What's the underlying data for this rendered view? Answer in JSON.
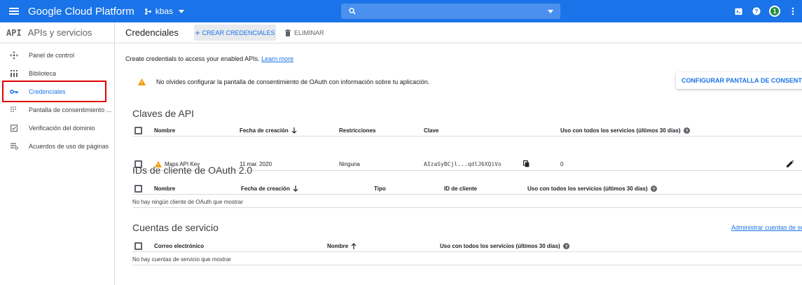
{
  "topbar": {
    "brand": "Google Cloud Platform",
    "project": "kbas",
    "search_value": "",
    "avatar_label": "1",
    "color": "#1a73e8"
  },
  "sidebar": {
    "logo": "API",
    "title": "APIs y servicios",
    "items": [
      {
        "label": "Panel de control",
        "icon": "dashboard-icon"
      },
      {
        "label": "Biblioteca",
        "icon": "library-icon"
      },
      {
        "label": "Credenciales",
        "icon": "key-icon",
        "active": true
      },
      {
        "label": "Pantalla de consentimiento ...",
        "icon": "consent-icon"
      },
      {
        "label": "Verificación del dominio",
        "icon": "domain-check-icon"
      },
      {
        "label": "Acuerdos de uso de páginas",
        "icon": "agreements-icon"
      }
    ]
  },
  "main": {
    "title": "Credenciales",
    "create_label": "CREAR CREDENCIALES",
    "delete_label": "ELIMINAR",
    "intro_text": "Create credentials to access your enabled APIs.",
    "intro_link": "Learn more",
    "alert_text": "No olvides configurar la pantalla de consentimiento de OAuth con información sobre tu aplicación.",
    "config_button": "CONFIGURAR PANTALLA DE CONSENTIMIENTO"
  },
  "api_keys": {
    "title": "Claves de API",
    "headers": [
      "Nombre",
      "Fecha de creación",
      "Restricciones",
      "Clave",
      "Uso con todos los servicios (últimos 30 días)"
    ],
    "rows": [
      {
        "name": "Maps API Key",
        "date": "11 mar. 2020",
        "restrictions": "Ninguna",
        "key": "AIzaSyBCjl...qdlJ6XQiVo",
        "usage": "0"
      }
    ]
  },
  "oauth": {
    "title": "IDs de cliente de OAuth 2.0",
    "headers": [
      "Nombre",
      "Fecha de creación",
      "Tipo",
      "ID de cliente",
      "Uso con todos los servicios (últimos 30 días)"
    ],
    "empty": "No hay ningún cliente de OAuth que mostrar"
  },
  "service_accounts": {
    "title": "Cuentas de servicio",
    "admin_link": "Administrar cuentas de servicio",
    "headers": [
      "Correo electrónico",
      "Nombre",
      "Uso con todos los servicios (últimos 30 días)"
    ],
    "empty": "No hay cuentas de servicio que mostrar"
  }
}
